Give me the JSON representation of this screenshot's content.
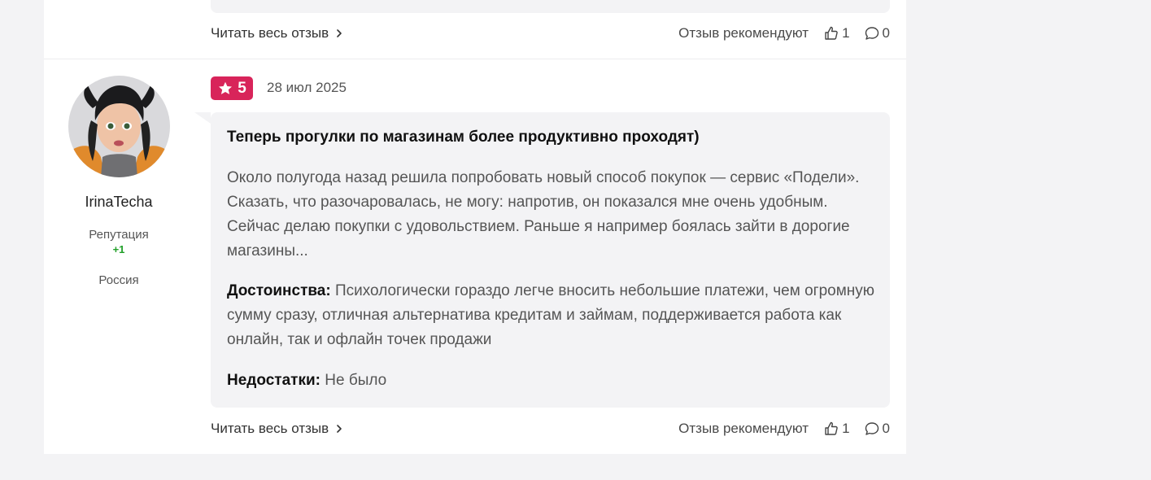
{
  "top_footer": {
    "read_more": "Читать весь отзыв",
    "recommend_label": "Отзыв рекомендуют",
    "likes": "1",
    "comments": "0"
  },
  "review": {
    "author": {
      "username": "IrinaTecha",
      "reputation_label": "Репутация",
      "reputation_value": "+1",
      "country": "Россия"
    },
    "rating": "5",
    "date": "28 июл 2025",
    "title": "Теперь прогулки по магазинам более продуктивно проходят)",
    "body": "Около полугода назад решила попробовать новый способ покупок — сервис «Подели». Сказать, что разочаровалась, не могу: напротив, он показался мне очень удобным. Сейчас делаю покупки с удовольствием. Раньше я например боялась зайти в дорогие магазины...",
    "pros_label": "Достоинства:",
    "pros": "Психологически гораздо легче вносить небольшие платежи, чем огромную сумму сразу, отличная альтернатива кредитам и займам, поддерживается работа как онлайн, так и офлайн точек продажи",
    "cons_label": "Недостатки:",
    "cons": "Не было",
    "footer": {
      "read_more": "Читать весь отзыв",
      "recommend_label": "Отзыв рекомендуют",
      "likes": "1",
      "comments": "0"
    }
  },
  "colors": {
    "rating_badge": "#d8245a",
    "reputation_positive": "#22a02a",
    "bubble_bg": "#f3f3f5"
  }
}
